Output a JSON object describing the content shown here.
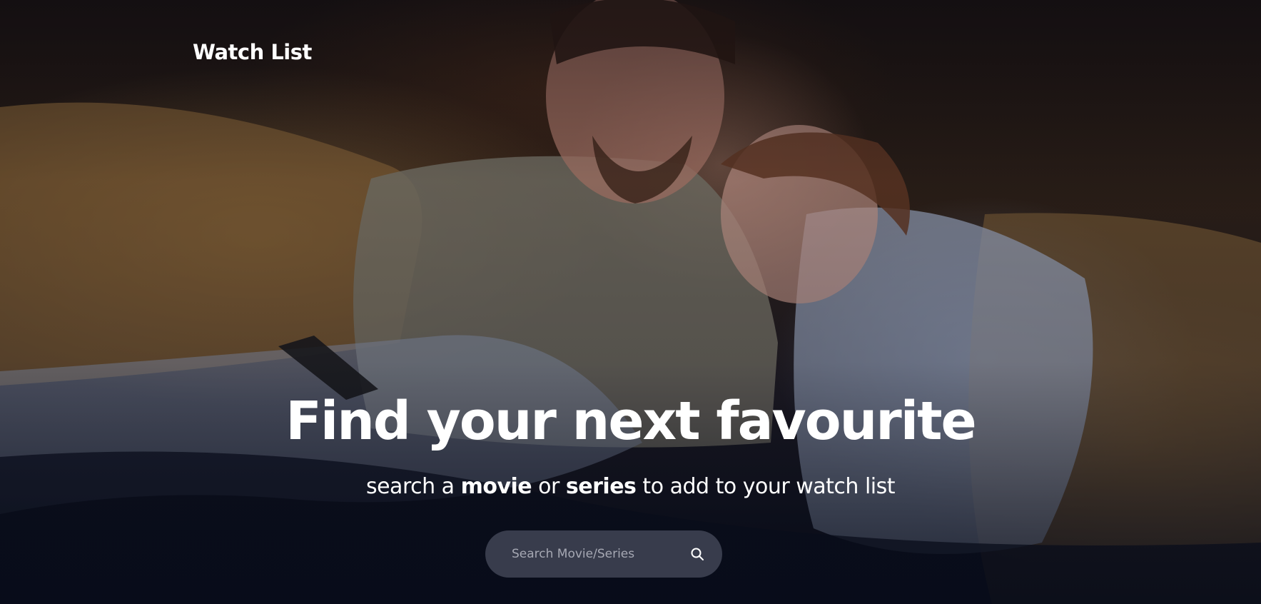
{
  "brand": {
    "title": "Watch List"
  },
  "hero": {
    "headline": "Find your next favourite",
    "subline": {
      "part1": "search a ",
      "movie": "movie",
      "part2": " or ",
      "series": "series",
      "part3": " to add to your watch list"
    },
    "background": "couple-watching-tv-photo"
  },
  "search": {
    "placeholder": "Search Movie/Series",
    "value": "",
    "icon": "search-icon"
  },
  "colors": {
    "text": "#ffffff",
    "search_bg": "#5f6476",
    "placeholder": "#a6a8b3"
  }
}
